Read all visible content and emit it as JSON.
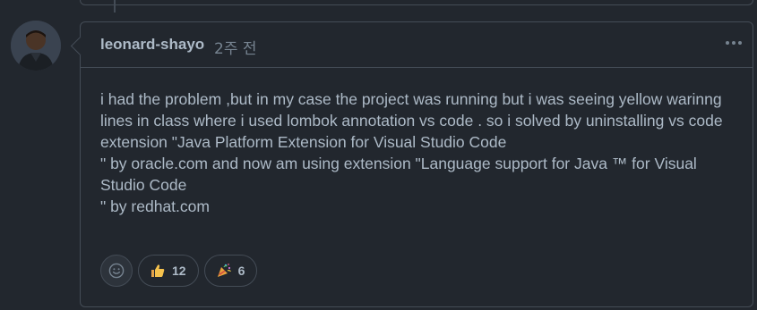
{
  "comment": {
    "author": "leonard-shayo",
    "time": "2주 전",
    "more_label": "...",
    "paragraphs": [
      "i had the problem ,but in my case the project was running but i was seeing yellow warinng lines in class where i used lombok annotation vs code . so i solved by uninstalling vs code extension \"Java Platform Extension for Visual Studio Code",
      "\" by oracle.com and now am using extension \"Language support for Java ™ for Visual Studio Code",
      "\" by redhat.com"
    ]
  },
  "reactions": [
    {
      "icon": "thumbs-up-icon",
      "count": "12"
    },
    {
      "icon": "tada-icon",
      "count": "6"
    }
  ],
  "colors": {
    "background": "#22272e",
    "border": "#444c56",
    "text": "#adbac7",
    "muted": "#768390"
  }
}
